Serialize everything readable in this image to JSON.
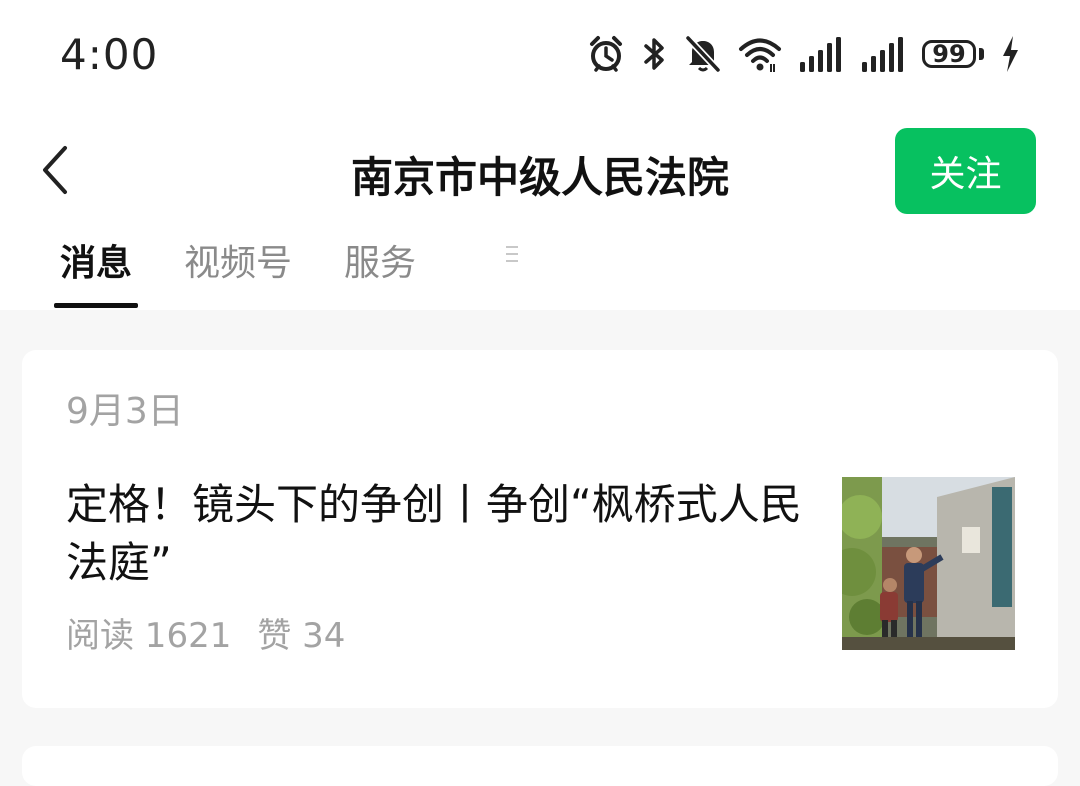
{
  "status_bar": {
    "time": "4:00",
    "battery": "99",
    "icons": [
      "alarm-icon",
      "bluetooth-icon",
      "mute-icon",
      "wifi-icon",
      "signal-icon",
      "signal-icon",
      "battery-icon",
      "charging-icon"
    ]
  },
  "header": {
    "back_icon": "chevron-left-icon",
    "title": "南京市中级人民法院",
    "follow_label": "关注"
  },
  "tabs": [
    {
      "label": "消息",
      "active": true
    },
    {
      "label": "视频号",
      "active": false
    },
    {
      "label": "服务",
      "active": false
    }
  ],
  "colors": {
    "accent": "#07c160",
    "page_bg": "#f7f7f7",
    "muted_text": "#a3a3a3"
  },
  "feed": {
    "date": "9月3日",
    "article": {
      "title": "定格！镜头下的争创丨争创“枫桥式人民法庭”",
      "reads": "阅读 1621",
      "likes": "赞 34"
    }
  }
}
